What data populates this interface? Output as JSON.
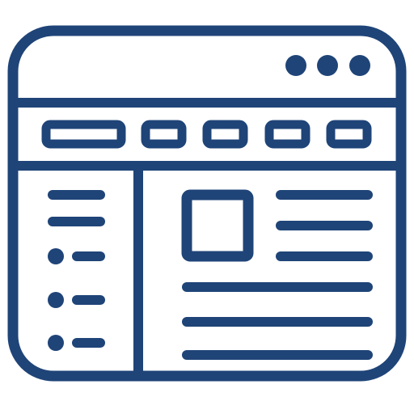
{
  "icon": {
    "name": "web-page-layout-icon",
    "stroke_color": "#1f4478",
    "background_color": "#ffffff",
    "window_controls": [
      "dot",
      "dot",
      "dot"
    ],
    "nav_buttons": [
      "wide-button",
      "button",
      "button",
      "button",
      "button"
    ],
    "sidebar_items": [
      "line",
      "line",
      "bullet-line",
      "bullet-line",
      "bullet-line"
    ],
    "content": {
      "image_placeholder": "square",
      "lines_beside_image": 3,
      "full_width_lines": 3
    }
  }
}
